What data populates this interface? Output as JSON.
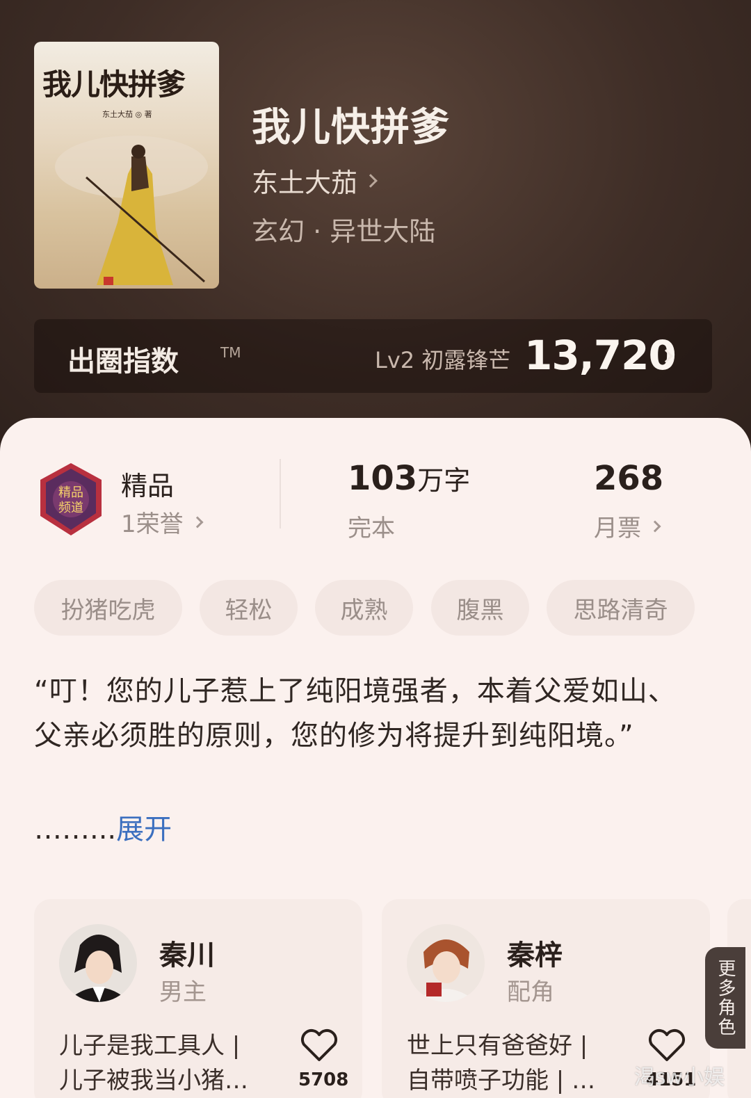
{
  "book": {
    "cover_title": "我儿快拼爹",
    "cover_author": "东土大茄 ◎ 著",
    "title": "我儿快拼爹",
    "author": "东土大茄",
    "genre": "玄幻 · 异世大陆"
  },
  "index": {
    "label": "出圈指数",
    "tm": "TM",
    "level": "Lv2 初露锋芒",
    "score": "13,720"
  },
  "stats": {
    "badge_label": "精品",
    "honor": "1荣誉",
    "words_num": "103",
    "words_unit": "万字",
    "status": "完本",
    "tickets_num": "268",
    "tickets_label": "月票"
  },
  "tags": [
    "扮猪吃虎",
    "轻松",
    "成熟",
    "腹黑",
    "思路清奇"
  ],
  "synopsis": {
    "text": "“叮！您的儿子惹上了纯阳境强者，本着父爱如山、父亲必须胜的原则，您的修为将提升到纯阳境。”",
    "ellipsis": "……...",
    "expand": "展开"
  },
  "characters": [
    {
      "name": "秦川",
      "role": "男主",
      "desc1": "儿子是我工具人 |",
      "desc2": "儿子被我当小猪…",
      "likes": "5708"
    },
    {
      "name": "秦梓",
      "role": "配角",
      "desc1": "世上只有爸爸好 |",
      "desc2": "自带喷子功能 | …",
      "likes": "4151"
    }
  ],
  "more_roles": "更多角色",
  "watermark": "渴sw小娱"
}
